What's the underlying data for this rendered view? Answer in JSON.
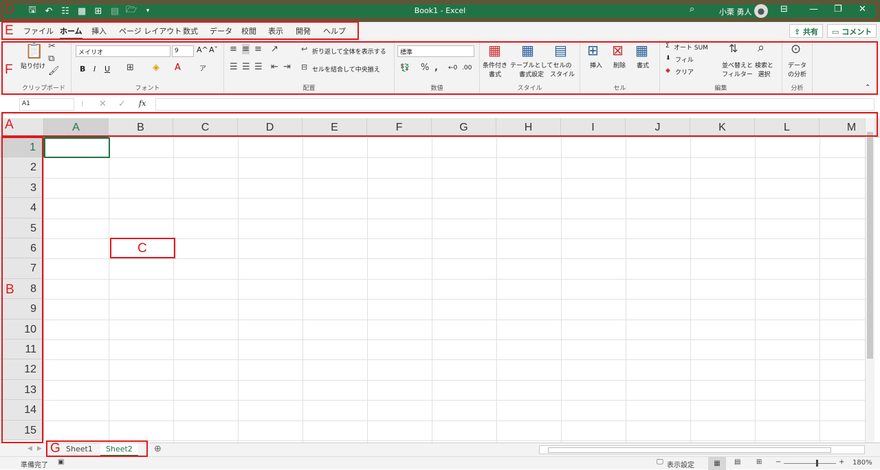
{
  "titlebar": {
    "title": "Book1  -  Excel",
    "user": "小栗 勇人",
    "avatar_icon": "person-icon",
    "qat_icons": [
      "save-icon",
      "undo-icon",
      "form-icon",
      "table-icon",
      "preview-icon",
      "print-icon",
      "open-icon",
      "customize-icon"
    ]
  },
  "tabs": [
    "ファイル",
    "ホーム",
    "挿入",
    "ページ レイアウト",
    "数式",
    "データ",
    "校閲",
    "表示",
    "開発",
    "ヘルプ"
  ],
  "active_tab": "ホーム",
  "top_buttons": {
    "share": "共有",
    "comment": "コメント"
  },
  "ribbon": {
    "clipboard": {
      "label": "クリップボード",
      "paste": "貼り付け"
    },
    "font": {
      "label": "フォント",
      "name": "メイリオ",
      "size": "9",
      "bold": "B",
      "italic": "I",
      "underline": "U"
    },
    "alignment": {
      "label": "配置",
      "wrap": "折り返して全体を表示する",
      "merge": "セルを結合して中央揃え"
    },
    "number": {
      "label": "数値",
      "format": "標準"
    },
    "styles": {
      "label": "スタイル",
      "conditional": "条件付き\n書式",
      "table": "テーブルとして\n書式設定",
      "cell": "セルの\nスタイル"
    },
    "cells": {
      "label": "セル",
      "insert": "挿入",
      "delete": "削除",
      "format": "書式"
    },
    "editing": {
      "label": "編集",
      "autosum": "オート SUM",
      "fill": "フィル",
      "clear": "クリア",
      "sort": "並べ替えと\nフィルター",
      "find": "検索と\n選択"
    },
    "analysis": {
      "label": "分析",
      "analyze": "データ\nの分析"
    }
  },
  "formula_bar": {
    "name_box": "A1",
    "fx": "fx",
    "value": ""
  },
  "columns": [
    "A",
    "B",
    "C",
    "D",
    "E",
    "F",
    "G",
    "H",
    "I",
    "J",
    "K",
    "L",
    "M"
  ],
  "rows": [
    "1",
    "2",
    "3",
    "4",
    "5",
    "6",
    "7",
    "8",
    "9",
    "10",
    "11",
    "12",
    "13",
    "14",
    "15"
  ],
  "selected_cell": "A1",
  "sheets": [
    "Sheet1",
    "Sheet2"
  ],
  "active_sheet": "Sheet2",
  "status": {
    "ready": "準備完了",
    "display_settings": "表示設定",
    "zoom": "180%"
  },
  "annotations": {
    "A": "A",
    "B": "B",
    "C": "C",
    "D": "D",
    "E": "E",
    "F": "F",
    "G": "G"
  },
  "colors": {
    "accent": "#217346",
    "annotation": "#e0191b"
  }
}
